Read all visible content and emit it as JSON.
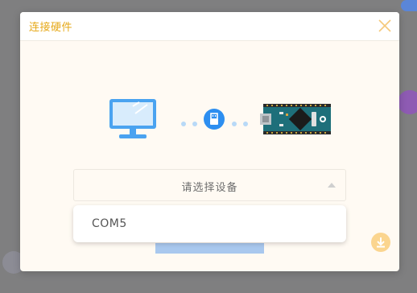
{
  "dialog": {
    "title": "连接硬件",
    "close_icon": "close-icon"
  },
  "illustration": {
    "computer_icon": "desktop-computer-icon",
    "link_icon": "usb-plug-icon",
    "board_icon": "arduino-nano-board-icon"
  },
  "device_select": {
    "placeholder": "请选择设备",
    "arrow_icon": "caret-up-icon",
    "options": [
      "COM5"
    ]
  },
  "footer": {
    "download_icon": "download-icon"
  },
  "colors": {
    "accent": "#e6a817",
    "primary_blue": "#4aa3f0",
    "button_blue": "#a9c8ee",
    "download_badge": "#fbd58f"
  }
}
